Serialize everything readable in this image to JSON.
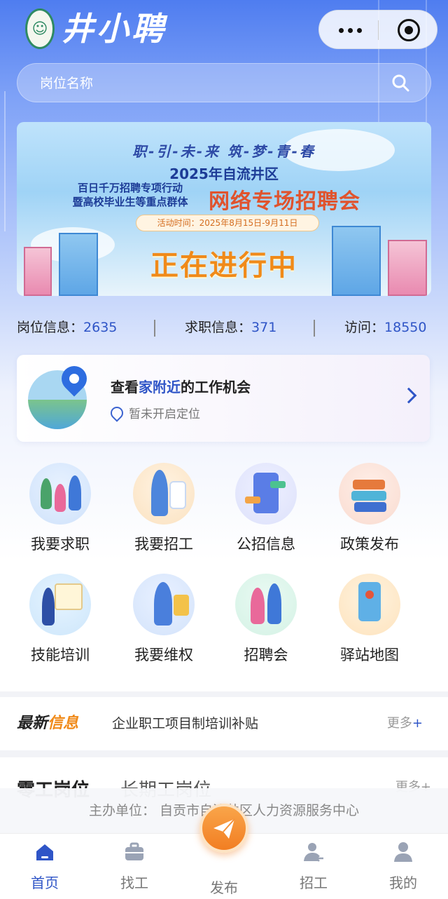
{
  "app": {
    "name": "井小聘"
  },
  "search": {
    "placeholder": "岗位名称"
  },
  "banner": {
    "slogan": "职-引-未-来    筑-梦-青-春",
    "year_title": "2025年自流井区",
    "subtitle_line1": "百日千万招聘专项行动",
    "subtitle_line2": "暨高校毕业生等重点群体",
    "event_name": "网络专场招聘会",
    "date_text": "活动时间：2025年8月15日-9月11日",
    "status": "正在进行中"
  },
  "stats": [
    {
      "label": "岗位信息：",
      "value": "2635"
    },
    {
      "label": "求职信息：",
      "value": "371"
    },
    {
      "label": "访问：",
      "value": "18550"
    }
  ],
  "nearby": {
    "title_pre": "查看",
    "title_highlight": "家附近",
    "title_post": "的工作机会",
    "location_status": "暂未开启定位"
  },
  "grid": [
    {
      "label": "我要求职",
      "icon": "job-seekers-icon"
    },
    {
      "label": "我要招工",
      "icon": "recruit-icon"
    },
    {
      "label": "公招信息",
      "icon": "public-recruitment-icon"
    },
    {
      "label": "政策发布",
      "icon": "policy-books-icon"
    },
    {
      "label": "技能培训",
      "icon": "training-icon"
    },
    {
      "label": "我要维权",
      "icon": "rights-protection-icon"
    },
    {
      "label": "招聘会",
      "icon": "job-fair-icon"
    },
    {
      "label": "驿站地图",
      "icon": "station-map-icon"
    }
  ],
  "news": {
    "tag_part1": "最新",
    "tag_part2": "信息",
    "headline": "企业职工项目制培训补贴",
    "more_label": "更多",
    "more_plus": "+"
  },
  "jobs": {
    "tab_short": "零工岗位",
    "tab_long": "长期工岗位",
    "more_label": "更多+"
  },
  "sponsor": "主办单位： 自贡市自流井区人力资源服务中心",
  "tabbar": [
    {
      "label": "首页",
      "icon": "home-icon",
      "active": true
    },
    {
      "label": "找工",
      "icon": "briefcase-icon",
      "active": false
    },
    {
      "label": "发布",
      "icon": "send-icon",
      "active": false
    },
    {
      "label": "招工",
      "icon": "recruiter-icon",
      "active": false
    },
    {
      "label": "我的",
      "icon": "user-icon",
      "active": false
    }
  ],
  "colors": {
    "primary": "#2f55c7",
    "accent": "#f08a19",
    "header_blue": "#4f7df0"
  }
}
